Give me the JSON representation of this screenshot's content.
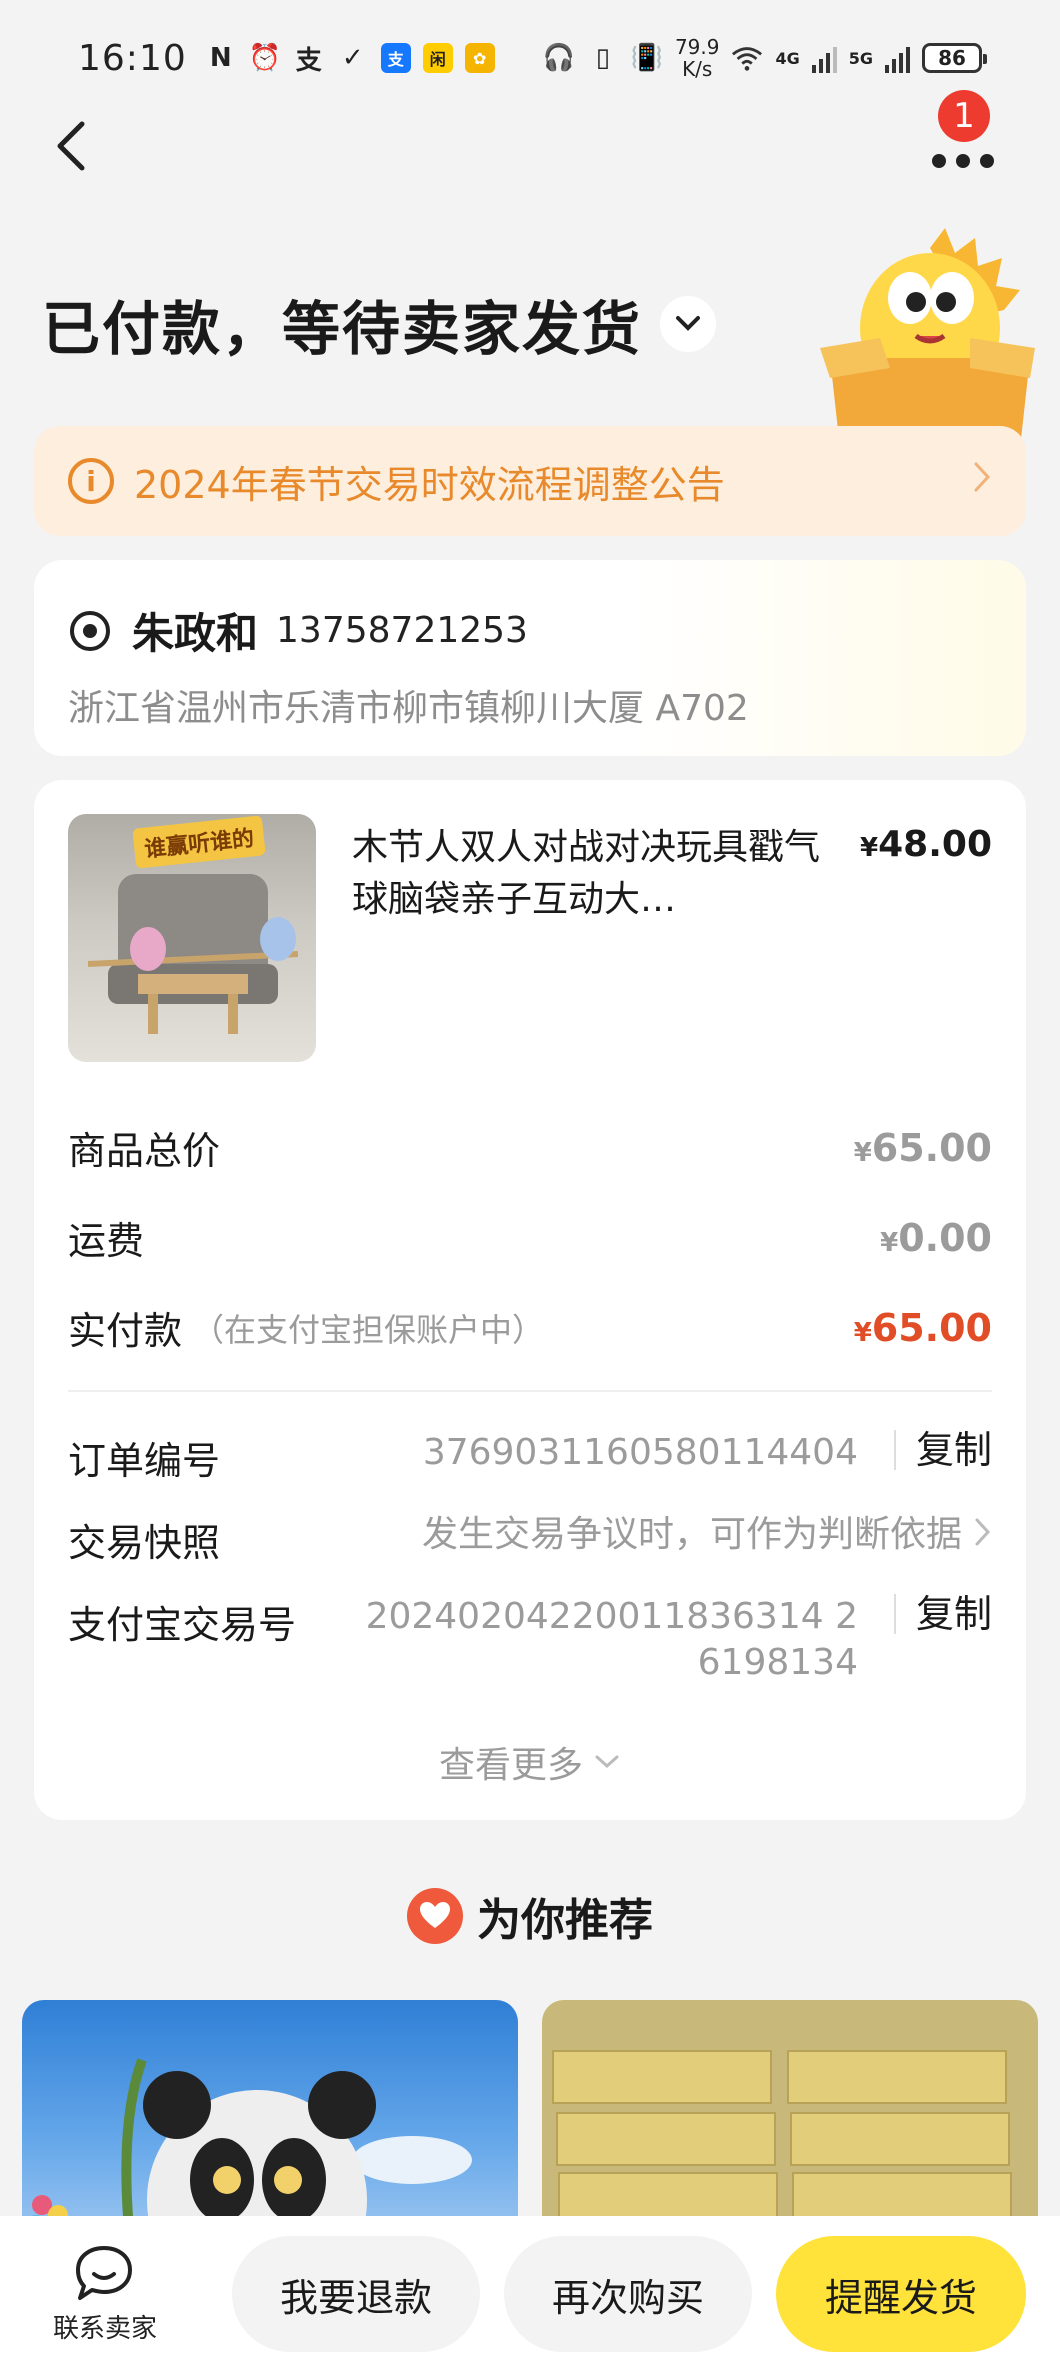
{
  "status_bar": {
    "time": "16:10",
    "net_speed_value": "79.9",
    "net_speed_unit": "K/s",
    "net_4g": "4G",
    "net_5g": "5G",
    "battery": "86"
  },
  "header": {
    "notification_count": "1",
    "title": "已付款，等待卖家发货"
  },
  "notice": {
    "text": "2024年春节交易时效流程调整公告"
  },
  "address": {
    "name": "朱政和",
    "phone": "13758721253",
    "detail": "浙江省温州市乐清市柳市镇柳川大厦 A702"
  },
  "product": {
    "image_tag": "谁赢听谁的",
    "title": "木节人双人对战对决玩具戳气球脑袋亲子互动大…",
    "price_symbol": "¥",
    "price": "48.00"
  },
  "fees": {
    "subtotal_label": "商品总价",
    "subtotal_value": "65.00",
    "shipping_label": "运费",
    "shipping_value": "0.00",
    "paid_label": "实付款",
    "paid_note": "（在支付宝担保账户中）",
    "paid_value": "65.00",
    "currency": "¥"
  },
  "order_info": {
    "order_no_label": "订单编号",
    "order_no": "3769031160580114404",
    "copy_label": "复制",
    "snapshot_label": "交易快照",
    "snapshot_value": "发生交易争议时，可作为判断依据",
    "alipay_label": "支付宝交易号",
    "alipay_no_line1": "20240204220011836314 2",
    "alipay_no_line2": "6198134",
    "see_more": "查看更多"
  },
  "recommend": {
    "title": "为你推荐"
  },
  "bottom_bar": {
    "contact_label": "联系卖家",
    "refund": "我要退款",
    "rebuy": "再次购买",
    "remind": "提醒发货"
  },
  "colors": {
    "accent_yellow": "#ffe23a",
    "price_red": "#e04d26",
    "notice_orange": "#e88a2b",
    "badge_red": "#ee3b2f"
  }
}
